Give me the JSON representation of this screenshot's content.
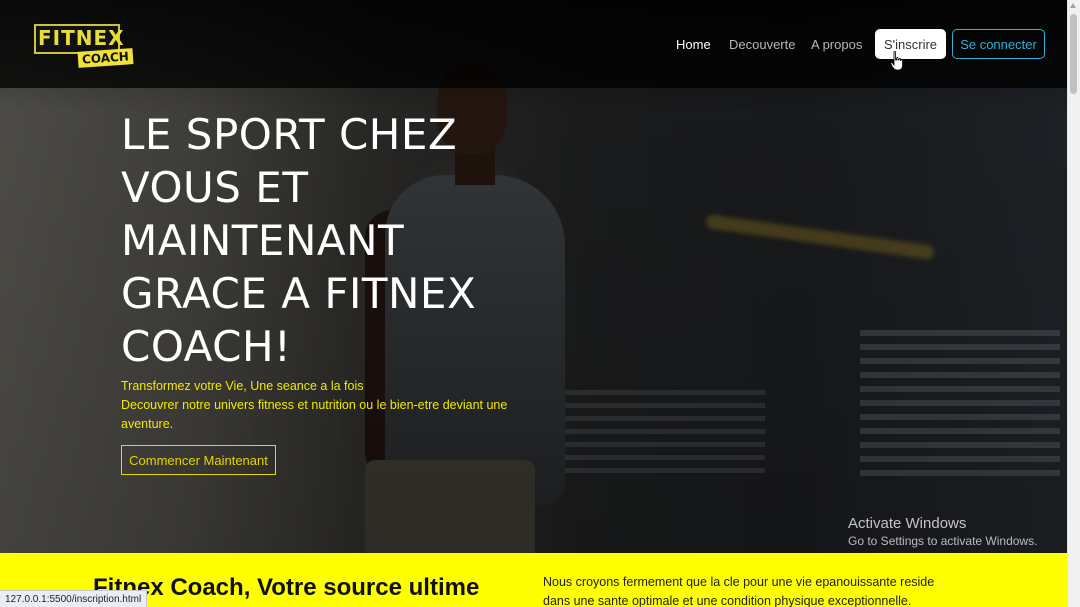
{
  "navbar": {
    "logo": {
      "top": "FITNEX",
      "bottom": "COACH"
    },
    "links": [
      {
        "label": "Home"
      },
      {
        "label": "Decouverte"
      },
      {
        "label": "A propos"
      }
    ],
    "signup_label": "S'inscrire",
    "login_label": "Se connecter"
  },
  "hero": {
    "title": "LE SPORT CHEZ VOUS ET MAINTENANT GRACE A FITNEX COACH!",
    "tagline_line1": "Transformez votre Vie, Une seance a la fois",
    "tagline_line2": "Decouvrer notre univers fitness et nutrition ou le bien-etre deviant une aventure.",
    "cta_label": "Commencer Maintenant"
  },
  "windows_watermark": {
    "title": "Activate Windows",
    "subtitle": "Go to Settings to activate Windows."
  },
  "intro": {
    "heading": "Fitnex Coach, Votre source ultime",
    "paragraph": "Nous croyons fermement que la cle pour une vie epanouissante reside dans une sante optimale et une condition physique exceptionnelle."
  },
  "status_bar": {
    "url": "127.0.0.1:5500/inscription.html"
  },
  "colors": {
    "accent_yellow": "#ffff00",
    "tagline_yellow": "#f2e900",
    "login_blue": "#2fb3d4"
  }
}
